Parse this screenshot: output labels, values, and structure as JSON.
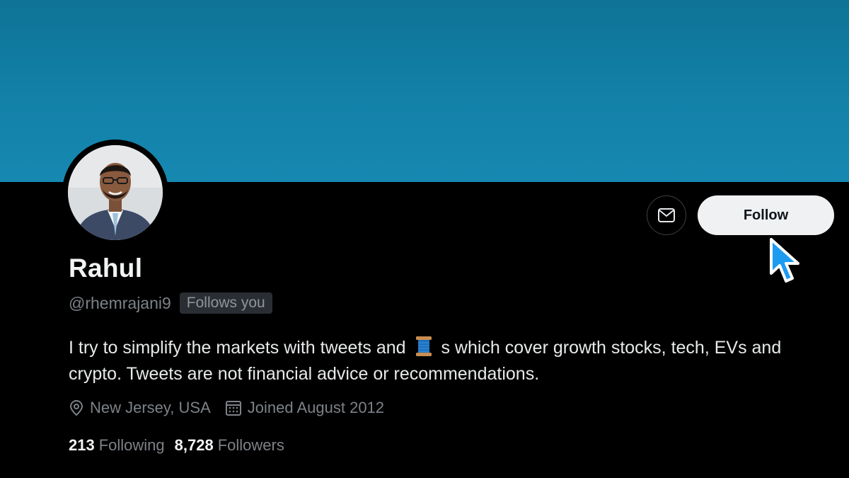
{
  "profile": {
    "name": "Rahul",
    "handle": "@rhemrajani9",
    "follows_you_badge": "Follows you",
    "bio_before_emoji": "I try to simplify the markets with tweets and",
    "bio_emoji": "spool-of-thread-icon",
    "bio_after_emoji": "s which cover growth stocks, tech, EVs and crypto. Tweets are not financial advice or recommendations.",
    "location": "New Jersey, USA",
    "joined": "Joined August 2012"
  },
  "actions": {
    "message_icon": "envelope-icon",
    "follow_label": "Follow"
  },
  "stats": {
    "following_count": "213",
    "following_label": "Following",
    "followers_count": "8,728",
    "followers_label": "Followers"
  },
  "colors": {
    "banner": "#1381a8",
    "background": "#000000",
    "follow_button": "#eff1f3",
    "muted_text": "#7d8287"
  }
}
